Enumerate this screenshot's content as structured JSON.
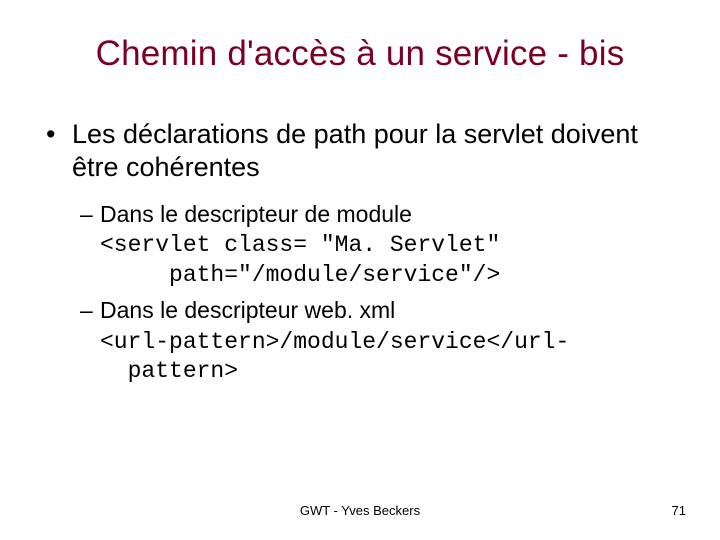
{
  "title": "Chemin d'accès à un service - bis",
  "bullet1": "Les déclarations de path pour la servlet doivent être cohérentes",
  "sub1": "Dans le descripteur de module",
  "code1": "<servlet class= \"Ma. Servlet\"\n     path=\"/module/service\"/>",
  "sub2": "Dans le descripteur web. xml",
  "code2": "<url-pattern>/module/service</url-\n  pattern>",
  "footer_center": "GWT - Yves Beckers",
  "footer_right": "71"
}
